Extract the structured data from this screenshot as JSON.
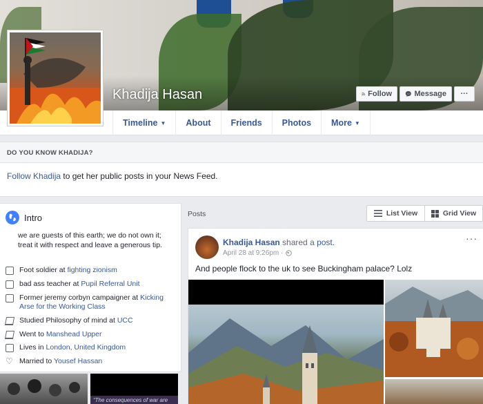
{
  "profile": {
    "name": "Khadija Hasan"
  },
  "cover_buttons": {
    "follow": "Follow",
    "message": "Message",
    "more": "···"
  },
  "nav": {
    "tabs": [
      {
        "label": "Timeline",
        "dropdown": true
      },
      {
        "label": "About"
      },
      {
        "label": "Friends"
      },
      {
        "label": "Photos"
      },
      {
        "label": "More",
        "dropdown": true
      }
    ]
  },
  "know_box": {
    "heading": "DO YOU KNOW KHADIJA?",
    "link": "Follow Khadija",
    "text": " to get her public posts in your News Feed."
  },
  "intro": {
    "title": "Intro",
    "bio": "we are guests of this earth; we do not own it; treat it with respect and leave a generous tip.",
    "items": [
      {
        "icon": "work-icon",
        "prefix": "Foot soldier at ",
        "link": "fighting zionism"
      },
      {
        "icon": "work-icon",
        "prefix": "bad ass teacher at ",
        "link": "Pupil Referral Unit"
      },
      {
        "icon": "work-icon",
        "prefix": "Former jeremy corbyn campaigner at ",
        "link": "Kicking Arse for the Working Class"
      },
      {
        "icon": "education-icon",
        "prefix": "Studied Philosophy of mind at ",
        "link": "UCC"
      },
      {
        "icon": "education-icon",
        "prefix": "Went to ",
        "link": "Manshead Upper"
      },
      {
        "icon": "home-icon",
        "prefix": "Lives in ",
        "link": "London, United Kingdom"
      },
      {
        "icon": "heart-icon",
        "prefix": "Married to ",
        "link": "Yousef Hassan"
      }
    ],
    "thumb_caption": "“The consequences of war are"
  },
  "posts": {
    "label": "Posts",
    "list_view": "List View",
    "grid_view": "Grid View"
  },
  "post": {
    "author": "Khadija Hasan",
    "action": " shared a ",
    "shared_link": "post.",
    "date": "April 28 at 9:26pm ·",
    "text": "And people flock to the uk to see Buckingham palace? Lolz",
    "more": "···"
  },
  "colors": {
    "link": "#365899",
    "background": "#e9ebee",
    "intro_globe": "#4080ff"
  }
}
